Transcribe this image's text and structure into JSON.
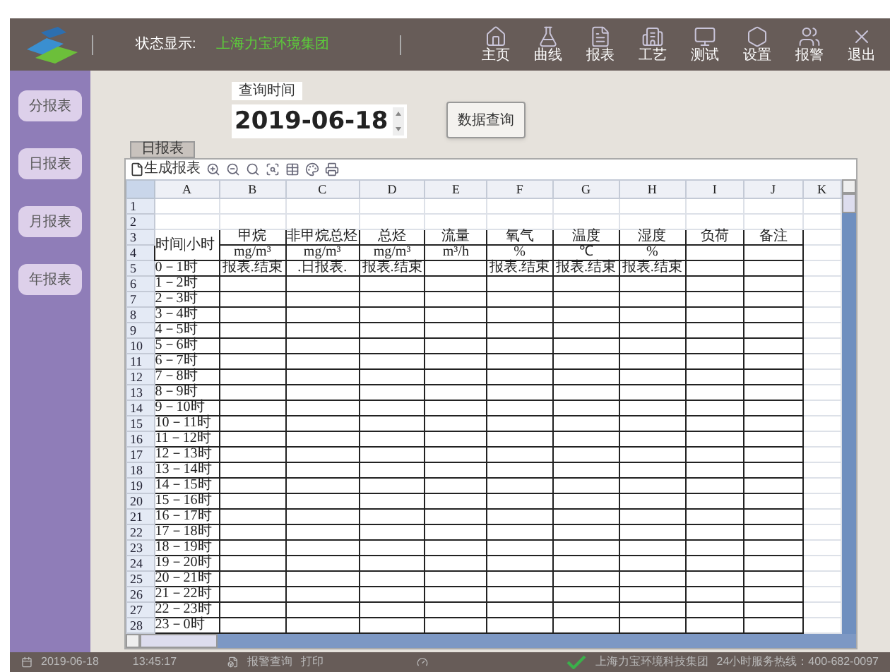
{
  "header": {
    "status_label": "状态显示:",
    "status_value": "上海力宝环境集团",
    "nav": [
      {
        "label": "主页"
      },
      {
        "label": "曲线"
      },
      {
        "label": "报表"
      },
      {
        "label": "工艺"
      },
      {
        "label": "测试"
      },
      {
        "label": "设置"
      },
      {
        "label": "报警"
      },
      {
        "label": "退出"
      }
    ]
  },
  "sidebar": {
    "items": [
      {
        "label": "分报表"
      },
      {
        "label": "日报表"
      },
      {
        "label": "月报表"
      },
      {
        "label": "年报表"
      }
    ]
  },
  "query": {
    "label": "查询时间",
    "date": "2019-06-18",
    "button": "数据查询"
  },
  "sheet_tab": "日报表",
  "toolbar": {
    "generate": "生成报表"
  },
  "table": {
    "columns": [
      "A",
      "B",
      "C",
      "D",
      "E",
      "F",
      "G",
      "H",
      "I",
      "J",
      "K"
    ],
    "rows": [
      {
        "n": "1",
        "framed": false,
        "cells": {}
      },
      {
        "n": "2",
        "framed": false,
        "cells": {}
      },
      {
        "n": "3",
        "framed": true,
        "cells": {
          "A": "时间|小时",
          "B": "甲烷",
          "C": "非甲烷总烃",
          "D": "总烃",
          "E": "流量",
          "F": "氧气",
          "G": "温度",
          "H": "湿度",
          "I": "负荷",
          "J": "备注"
        }
      },
      {
        "n": "4",
        "framed": true,
        "cells": {
          "B": "mg/m³",
          "C": "mg/m³",
          "D": "mg/m³",
          "E": "m³/h",
          "F": "%",
          "G": "℃",
          "H": "%"
        }
      },
      {
        "n": "5",
        "framed": true,
        "cells": {
          "A": "0－1时",
          "B": "报表.结束",
          "C": ".日报表.",
          "D": "报表.结束",
          "F": "报表.结束",
          "G": "报表.结束",
          "H": "报表.结束"
        }
      },
      {
        "n": "6",
        "framed": true,
        "cells": {
          "A": "1－2时"
        }
      },
      {
        "n": "7",
        "framed": true,
        "cells": {
          "A": "2－3时"
        }
      },
      {
        "n": "8",
        "framed": true,
        "cells": {
          "A": "3－4时"
        }
      },
      {
        "n": "9",
        "framed": true,
        "cells": {
          "A": "4－5时"
        }
      },
      {
        "n": "10",
        "framed": true,
        "cells": {
          "A": "5－6时"
        }
      },
      {
        "n": "11",
        "framed": true,
        "cells": {
          "A": "6－7时"
        }
      },
      {
        "n": "12",
        "framed": true,
        "cells": {
          "A": "7－8时"
        }
      },
      {
        "n": "13",
        "framed": true,
        "cells": {
          "A": "8－9时"
        }
      },
      {
        "n": "14",
        "framed": true,
        "cells": {
          "A": "9－10时"
        }
      },
      {
        "n": "15",
        "framed": true,
        "cells": {
          "A": "10－11时"
        }
      },
      {
        "n": "16",
        "framed": true,
        "cells": {
          "A": "11－12时"
        }
      },
      {
        "n": "17",
        "framed": true,
        "cells": {
          "A": "12－13时"
        }
      },
      {
        "n": "18",
        "framed": true,
        "cells": {
          "A": "13－14时"
        }
      },
      {
        "n": "19",
        "framed": true,
        "cells": {
          "A": "14－15时"
        }
      },
      {
        "n": "20",
        "framed": true,
        "cells": {
          "A": "15－16时"
        }
      },
      {
        "n": "21",
        "framed": true,
        "cells": {
          "A": "16－17时"
        }
      },
      {
        "n": "22",
        "framed": true,
        "cells": {
          "A": "17－18时"
        }
      },
      {
        "n": "23",
        "framed": true,
        "cells": {
          "A": "18－19时"
        }
      },
      {
        "n": "24",
        "framed": true,
        "cells": {
          "A": "19－20时"
        }
      },
      {
        "n": "25",
        "framed": true,
        "cells": {
          "A": "20－21时"
        }
      },
      {
        "n": "26",
        "framed": true,
        "cells": {
          "A": "21－22时"
        }
      },
      {
        "n": "27",
        "framed": true,
        "cells": {
          "A": "22－23时"
        }
      },
      {
        "n": "28",
        "framed": true,
        "cells": {
          "A": "23－0时"
        }
      }
    ]
  },
  "status_bar": {
    "date": "2019-06-18",
    "time": "13:45:17",
    "alarm": "报警查询",
    "print": "打印",
    "company": "上海力宝环境科技集团",
    "hotline": "24小时服务热线：400-682-0097"
  }
}
